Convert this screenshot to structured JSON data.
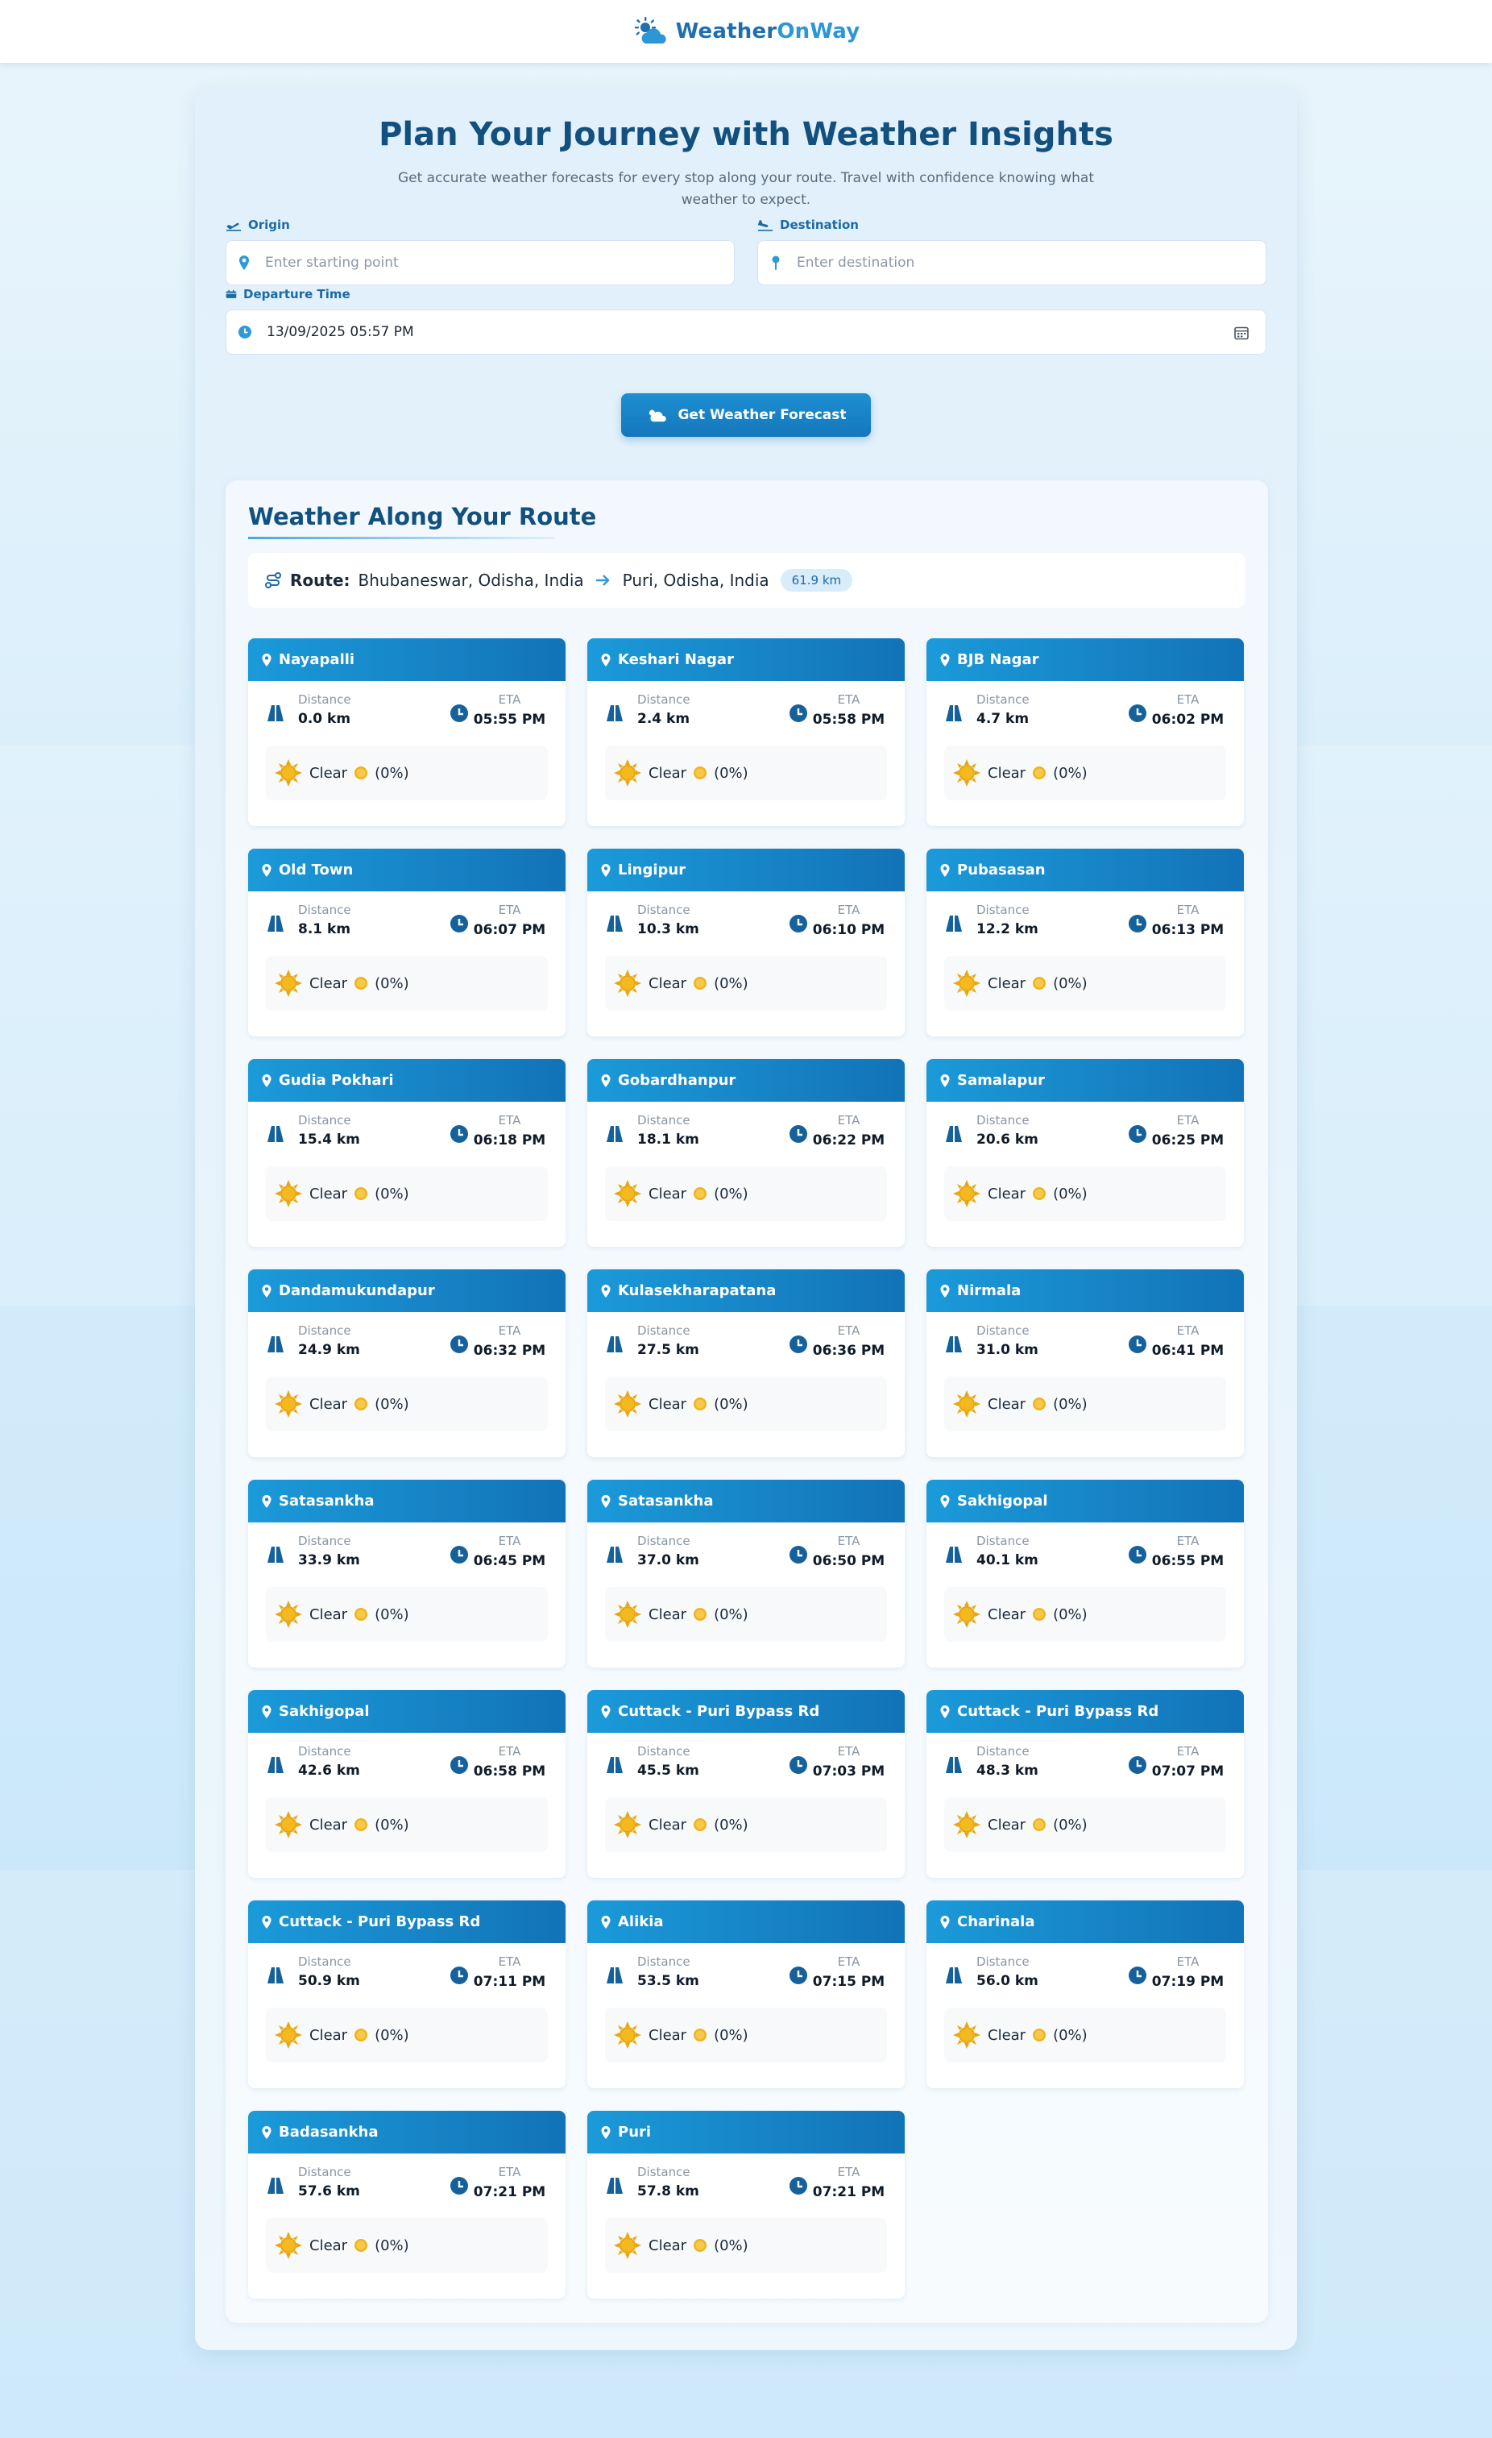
{
  "brand": {
    "name_part1": "Weather",
    "name_part2": "OnWay",
    "logo": "sun-cloud-icon"
  },
  "hero": {
    "title": "Plan Your Journey with Weather Insights",
    "subtitle": "Get accurate weather forecasts for every stop along your route. Travel with confidence knowing what weather to expect."
  },
  "form": {
    "origin_label": "Origin",
    "origin_placeholder": "Enter starting point",
    "destination_label": "Destination",
    "destination_placeholder": "Enter destination",
    "departure_label": "Departure Time",
    "departure_value": "13/09/2025 05:57 PM",
    "submit_label": "Get Weather Forecast"
  },
  "results": {
    "title": "Weather Along Your Route",
    "route_label": "Route:",
    "route_from": "Bhubaneswar, Odisha, India",
    "route_to": "Puri, Odisha, India",
    "route_distance": "61.9 km"
  },
  "labels": {
    "distance": "Distance",
    "eta": "ETA",
    "precip": "(0%)"
  },
  "stops": [
    {
      "name": "Nayapalli",
      "distance": "0.0 km",
      "eta": "05:55 PM",
      "condition": "Clear"
    },
    {
      "name": "Keshari Nagar",
      "distance": "2.4 km",
      "eta": "05:58 PM",
      "condition": "Clear"
    },
    {
      "name": "BJB Nagar",
      "distance": "4.7 km",
      "eta": "06:02 PM",
      "condition": "Clear"
    },
    {
      "name": "Old Town",
      "distance": "8.1 km",
      "eta": "06:07 PM",
      "condition": "Clear"
    },
    {
      "name": "Lingipur",
      "distance": "10.3 km",
      "eta": "06:10 PM",
      "condition": "Clear"
    },
    {
      "name": "Pubasasan",
      "distance": "12.2 km",
      "eta": "06:13 PM",
      "condition": "Clear"
    },
    {
      "name": "Gudia Pokhari",
      "distance": "15.4 km",
      "eta": "06:18 PM",
      "condition": "Clear"
    },
    {
      "name": "Gobardhanpur",
      "distance": "18.1 km",
      "eta": "06:22 PM",
      "condition": "Clear"
    },
    {
      "name": "Samalapur",
      "distance": "20.6 km",
      "eta": "06:25 PM",
      "condition": "Clear"
    },
    {
      "name": "Dandamukundapur",
      "distance": "24.9 km",
      "eta": "06:32 PM",
      "condition": "Clear"
    },
    {
      "name": "Kulasekharapatana",
      "distance": "27.5 km",
      "eta": "06:36 PM",
      "condition": "Clear"
    },
    {
      "name": "Nirmala",
      "distance": "31.0 km",
      "eta": "06:41 PM",
      "condition": "Clear"
    },
    {
      "name": "Satasankha",
      "distance": "33.9 km",
      "eta": "06:45 PM",
      "condition": "Clear"
    },
    {
      "name": "Satasankha",
      "distance": "37.0 km",
      "eta": "06:50 PM",
      "condition": "Clear"
    },
    {
      "name": "Sakhigopal",
      "distance": "40.1 km",
      "eta": "06:55 PM",
      "condition": "Clear"
    },
    {
      "name": "Sakhigopal",
      "distance": "42.6 km",
      "eta": "06:58 PM",
      "condition": "Clear"
    },
    {
      "name": "Cuttack - Puri Bypass Rd",
      "distance": "45.5 km",
      "eta": "07:03 PM",
      "condition": "Clear"
    },
    {
      "name": "Cuttack - Puri Bypass Rd",
      "distance": "48.3 km",
      "eta": "07:07 PM",
      "condition": "Clear"
    },
    {
      "name": "Cuttack - Puri Bypass Rd",
      "distance": "50.9 km",
      "eta": "07:11 PM",
      "condition": "Clear"
    },
    {
      "name": "Alikia",
      "distance": "53.5 km",
      "eta": "07:15 PM",
      "condition": "Clear"
    },
    {
      "name": "Charinala",
      "distance": "56.0 km",
      "eta": "07:19 PM",
      "condition": "Clear"
    },
    {
      "name": "Badasankha",
      "distance": "57.6 km",
      "eta": "07:21 PM",
      "condition": "Clear"
    },
    {
      "name": "Puri",
      "distance": "57.8 km",
      "eta": "07:21 PM",
      "condition": "Clear"
    }
  ],
  "colors": {
    "brand_primary": "#1f6fae",
    "header_gradient_start": "#1b9ad9",
    "header_gradient_end": "#1273b7",
    "sun": "#f0b41c"
  }
}
